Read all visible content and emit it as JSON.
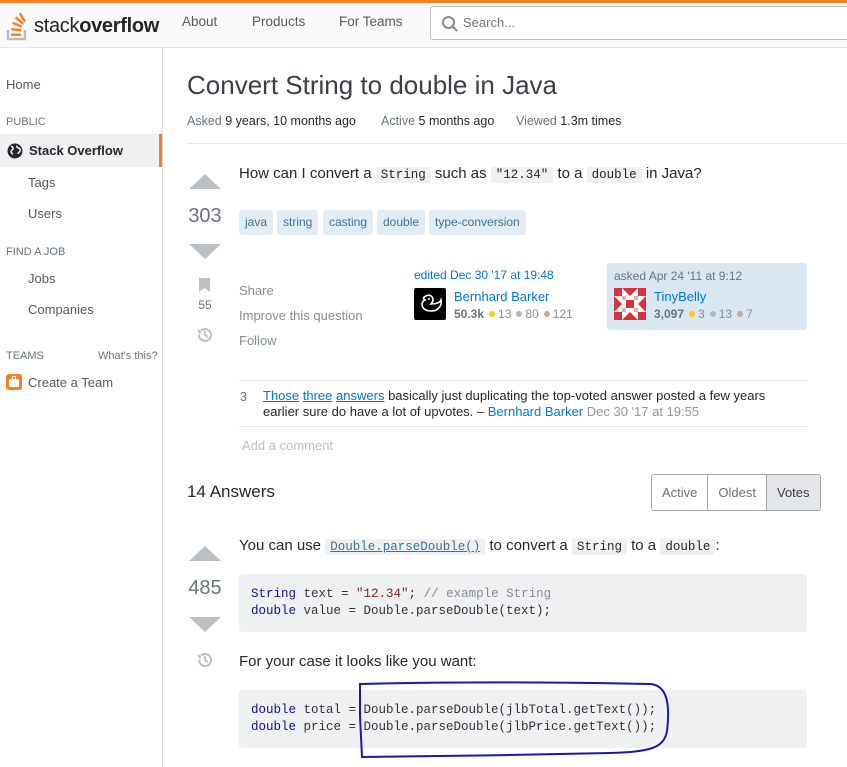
{
  "header": {
    "logo_text_light": "stack",
    "logo_text_bold": "overflow",
    "nav": [
      "About",
      "Products",
      "For Teams"
    ],
    "search_placeholder": "Search..."
  },
  "sidebar": {
    "home": "Home",
    "public_heading": "PUBLIC",
    "stack_overflow": "Stack Overflow",
    "tags": "Tags",
    "users": "Users",
    "find_job_heading": "FIND A JOB",
    "jobs": "Jobs",
    "companies": "Companies",
    "teams_heading": "TEAMS",
    "whats_this": "What's this?",
    "create_team": "Create a Team"
  },
  "question": {
    "title": "Convert String to double in Java",
    "asked_label": "Asked",
    "asked_value": "9 years, 10 months ago",
    "active_label": "Active",
    "active_value": "5 months ago",
    "viewed_label": "Viewed",
    "viewed_value": "1.3m times",
    "votes": "303",
    "bookmarks": "55",
    "body_pre": "How can I convert a ",
    "body_code1": "String",
    "body_mid1": " such as ",
    "body_code2": "\"12.34\"",
    "body_mid2": " to a ",
    "body_code3": "double",
    "body_post": " in Java?",
    "tags": [
      "java",
      "string",
      "casting",
      "double",
      "type-conversion"
    ],
    "menu": [
      "Share",
      "Improve this question",
      "Follow"
    ],
    "editor": {
      "action": "edited Dec 30 '17 at 19:48",
      "name": "Bernhard Barker",
      "rep": "50.3k",
      "gold": "13",
      "silver": "80",
      "bronze": "121"
    },
    "owner": {
      "action": "asked Apr 24 '11 at 9:12",
      "name": "TinyBelly",
      "rep": "3,097",
      "gold": "3",
      "silver": "13",
      "bronze": "7"
    },
    "comment": {
      "score": "3",
      "link1": "Those",
      "link2": "three",
      "link3": "answers",
      "text": " basically just duplicating the top-voted answer posted a few years earlier sure do have a lot of upvotes. – ",
      "user": "Bernhard Barker",
      "date": "Dec 30 '17 at 19:55"
    },
    "add_comment": "Add a comment"
  },
  "answers": {
    "count_label": "14 Answers",
    "sort_tabs": [
      "Active",
      "Oldest",
      "Votes"
    ],
    "selected_tab": "Votes",
    "top_answer": {
      "votes": "485",
      "intro_pre": "You can use ",
      "intro_code1": "Double.parseDouble()",
      "intro_mid": " to convert a ",
      "intro_code2": "String",
      "intro_mid2": " to a ",
      "intro_code3": "double",
      "intro_post": ":",
      "code1_line1": [
        "String",
        " text = ",
        "\"12.34\"",
        "; ",
        "// example String"
      ],
      "code1_line2": [
        "double",
        " value = Double.parseDouble(text);"
      ],
      "case_text": "For your case it looks like you want:",
      "code2_line1": [
        "double",
        " total = Double.parseDouble(jlbTotal.getText());"
      ],
      "code2_line2": [
        "double",
        " price = Double.parseDouble(jlbPrice.getText());"
      ]
    }
  },
  "colors": {
    "accent": "#f48024",
    "link": "#0077cc",
    "tag_bg": "#e1ecf4",
    "tag_fg": "#39739d",
    "annotation": "#1a1aa6"
  }
}
